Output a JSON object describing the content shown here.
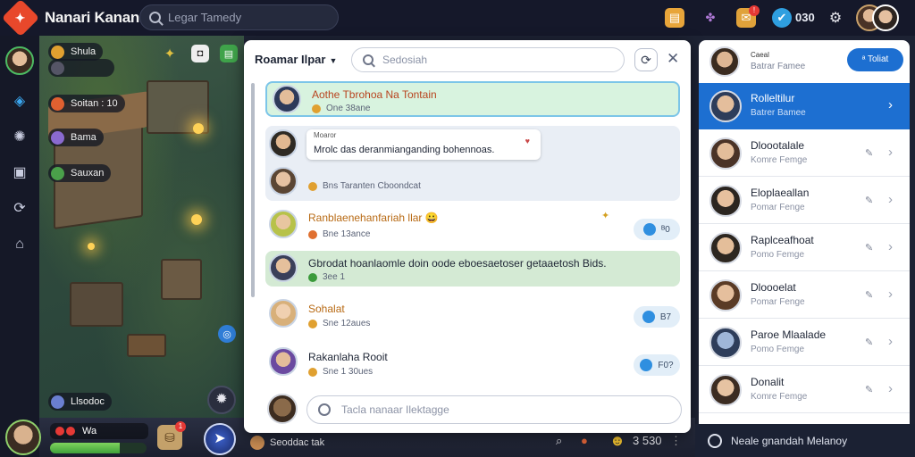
{
  "app": {
    "title": "Nanari Kanan",
    "logo_glyph": "✦"
  },
  "top_search": {
    "placeholder": "Legar Tamedy"
  },
  "top_right": {
    "coin_label": "030",
    "coins": "030",
    "icons": [
      "scroll-icon",
      "guild-icon",
      "mail-icon",
      "vip-icon",
      "settings-icon"
    ]
  },
  "rail": {
    "icons": [
      "quest-icon",
      "map-icon",
      "book-icon",
      "share-icon",
      "home-icon"
    ]
  },
  "hud": {
    "pills": [
      {
        "label": "Shula",
        "color": "#e0a030"
      },
      {
        "label": "Soitan : 10",
        "color": "#e06030"
      },
      {
        "label": "Bama",
        "color": "#8a6ad0"
      },
      {
        "label": "Sauxan",
        "color": "#4aa04a"
      }
    ],
    "badge": "Llsodoc"
  },
  "game_bar": {
    "hp_label": "Wa",
    "xp_fraction": 0.72,
    "bag_badge": "1",
    "bottom_label": "Seoddac tak",
    "right_status": "3 530"
  },
  "chat": {
    "room_title": "Roamar Ilpar",
    "search_placeholder": "Sedosiah",
    "rows": [
      {
        "name": "Aothe  Tbrohoa Na Tontain",
        "meta": "One 38ane",
        "bg": "#d8f3df",
        "border": "#7cc5e8",
        "dot": "#e0a030"
      },
      {
        "bubble_top": "Moaror",
        "bubble_msg": "Mrolc das deranmianganding bohennoas.",
        "meta": "Bns Taranten Cboondcat",
        "bg": "#e9eef5",
        "dot": "#e0a030"
      },
      {
        "name": "Ranblaenehanfariah  llar 😀",
        "meta": "Bne 13ance",
        "pill": "ᴮ0",
        "bg": "#ffffff",
        "dot": "#e07030"
      },
      {
        "name": "Gbrodat  hoanlaomle  doin  oode eboesaetoser  getaaetosh Bids.",
        "meta": "3ee 1",
        "bg": "#d4ead4",
        "dot": "#3a9a3a"
      },
      {
        "name": "Sohalat",
        "meta": "Sne 12aues",
        "pill": "B7",
        "bg": "#ffffff",
        "dot": "#e0a030"
      },
      {
        "name": "Rakanlaha  Rooit",
        "meta": "Sne 1 30ues",
        "pill": "F0?",
        "bg": "#ffffff",
        "dot": "#e0a030"
      }
    ],
    "composer_placeholder": "Tacla nanaar Ilektagge"
  },
  "friends": {
    "header_title": "Caeal",
    "header_sub": "Batrar Famee",
    "header_button": "ᵃ Toliat",
    "items": [
      {
        "name": "Rolleltilur",
        "status": "Batrer Bamee"
      },
      {
        "name": "Dloootalale",
        "status": "Komre Femge"
      },
      {
        "name": "Eloplaeallan",
        "status": "Pomar Fenge"
      },
      {
        "name": "Raplceafhoat",
        "status": "Pomo Femge"
      },
      {
        "name": "Dloooelat",
        "status": "Pomar Fenge"
      },
      {
        "name": "Paroe Mlaalade",
        "status": "Pomo Femge"
      },
      {
        "name": "Donalit",
        "status": "Komre Femge"
      }
    ],
    "footer": "Neale gnandah  Melanoy"
  }
}
